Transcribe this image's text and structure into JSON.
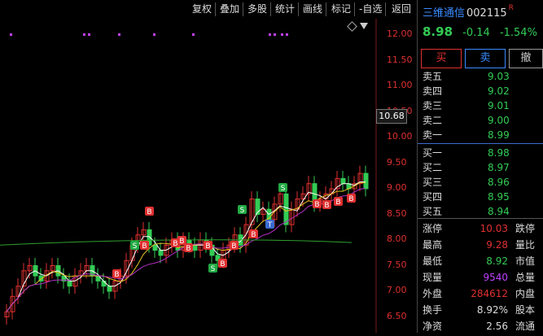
{
  "toolbar": [
    "复权",
    "叠加",
    "多股",
    "统计",
    "画线",
    "标记",
    "-自选",
    "返回"
  ],
  "chart": {
    "y_ticks": [
      "12.00",
      "11.50",
      "11.00",
      "10.50",
      "10.00",
      "9.50",
      "9.00",
      "8.50",
      "8.00",
      "7.50",
      "7.00",
      "6.50"
    ],
    "current_price_tag": "10.68",
    "marker_labels": {
      "buy": "B",
      "sell": "S",
      "t": "T"
    },
    "colors": {
      "up": "#e03030",
      "down": "#33cc55",
      "ma_white": "#ffffff",
      "ma_yellow": "#e0c020",
      "ma_magenta": "#b030c0",
      "ma_green": "#30a030"
    }
  },
  "stock": {
    "name": "三维通信",
    "code": "002115",
    "flag": "R",
    "price": "8.98",
    "change": "-0.14",
    "change_pct": "-1.54%"
  },
  "trade_buttons": {
    "buy": "买",
    "sell": "卖",
    "cancel": "撤"
  },
  "asks": [
    {
      "label": "卖五",
      "price": "9.03"
    },
    {
      "label": "卖四",
      "price": "9.02"
    },
    {
      "label": "卖三",
      "price": "9.01"
    },
    {
      "label": "卖二",
      "price": "9.00"
    },
    {
      "label": "卖一",
      "price": "8.99"
    }
  ],
  "bids": [
    {
      "label": "买一",
      "price": "8.98"
    },
    {
      "label": "买二",
      "price": "8.97"
    },
    {
      "label": "买三",
      "price": "8.96"
    },
    {
      "label": "买四",
      "price": "8.95"
    },
    {
      "label": "买五",
      "price": "8.94"
    }
  ],
  "stats": [
    {
      "label": "涨停",
      "value": "10.03",
      "label2": "跌停"
    },
    {
      "label": "最高",
      "value": "9.28",
      "label2": "量比"
    },
    {
      "label": "最低",
      "value": "8.92",
      "label2": "市值"
    },
    {
      "label": "现量",
      "value": "9540",
      "label2": "总量"
    },
    {
      "label": "外盘",
      "value": "284612",
      "label2": "内盘"
    },
    {
      "label": "换手",
      "value": "8.92%",
      "label2": "股本"
    },
    {
      "label": "净资",
      "value": "2.56",
      "label2": "流通"
    }
  ]
}
